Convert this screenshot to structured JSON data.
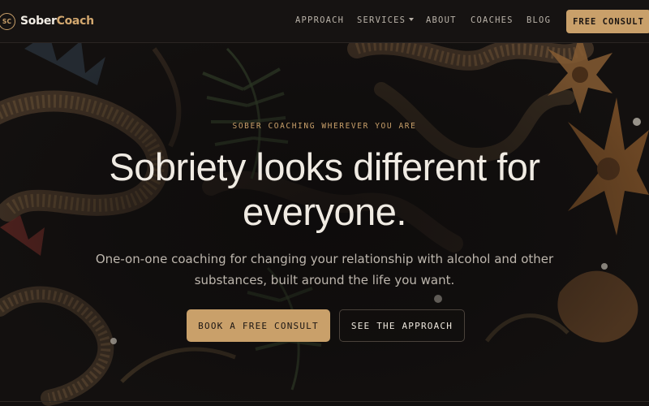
{
  "brand": {
    "logo_mark": "SC",
    "name_part1": "Sober",
    "name_part2": "Coach"
  },
  "nav": {
    "items": [
      {
        "label": "APPROACH"
      },
      {
        "label": "SERVICES",
        "has_dropdown": true
      },
      {
        "label": "ABOUT"
      },
      {
        "label": "COACHES"
      },
      {
        "label": "BLOG"
      }
    ],
    "cta_label": "FREE CONSULT"
  },
  "hero": {
    "eyebrow": "SOBER COACHING WHEREVER YOU ARE",
    "headline": "Sobriety looks different for everyone.",
    "subtext": "One-on-one coaching for changing your relationship with alcohol and other substances, built around the life you want.",
    "primary_cta": "BOOK A FREE CONSULT",
    "secondary_cta": "SEE THE APPROACH",
    "background": "embroidered-dragon-floral-pattern"
  },
  "icons": {
    "dropdown": "caret-down-icon"
  },
  "colors": {
    "accent": "#c9a06a",
    "background": "#141110",
    "text": "#f0ebe3",
    "muted_text": "#bdb6ad"
  }
}
